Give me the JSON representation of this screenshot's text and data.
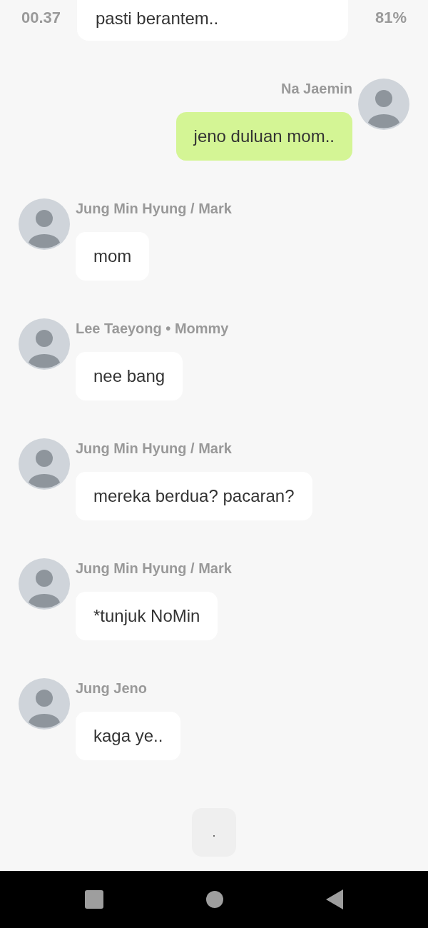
{
  "status_bar": {
    "time": "00.37",
    "battery": "81%"
  },
  "top_message": {
    "text": "pasti berantem.."
  },
  "messages": [
    {
      "kind": "outgoing",
      "sender": "Na Jaemin",
      "text": "jeno duluan mom.."
    },
    {
      "kind": "incoming",
      "sender": "Jung Min Hyung / Mark",
      "text": "mom"
    },
    {
      "kind": "incoming",
      "sender": "Lee Taeyong • Mommy",
      "text": "nee bang"
    },
    {
      "kind": "incoming",
      "sender": "Jung Min Hyung / Mark",
      "text": "mereka berdua? pacaran?"
    },
    {
      "kind": "incoming",
      "sender": "Jung Min Hyung / Mark",
      "text": "*tunjuk NoMin"
    },
    {
      "kind": "incoming",
      "sender": "Jung Jeno",
      "text": "kaga ye.."
    }
  ],
  "typing": {
    "text": "."
  }
}
